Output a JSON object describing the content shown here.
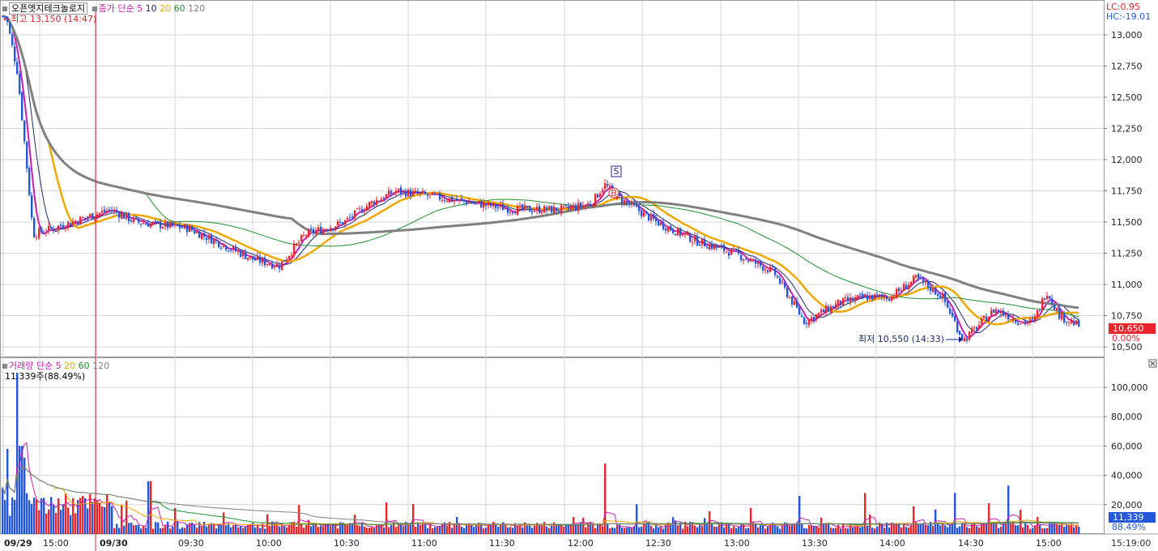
{
  "header": {
    "stock_name": "오픈엣지테크놀로지",
    "price_label": "종가",
    "ma_type": "단순",
    "ma_periods": [
      "5",
      "10",
      "20",
      "60",
      "120"
    ],
    "high_note": "←최고 13,150 (14:47)",
    "lc": "LC:0.95",
    "hc": "HC:-19.01"
  },
  "volume_header": {
    "label": "거래량",
    "ma_type": "단순",
    "ma_periods": [
      "5",
      "20",
      "60",
      "120"
    ],
    "summary": "11,339주(88.49%)"
  },
  "annotations": {
    "low_note": "최저 10,550 (14:33)",
    "current_price": "10,650",
    "current_change": "0.00%",
    "current_volume": "11,339",
    "current_volume_pct": "88.49%",
    "sell_marker": "S",
    "buy_marker": "B",
    "clock": "15:19:00"
  },
  "colors": {
    "up": "#e8262b",
    "down": "#2356d8",
    "ma5": "#c81fb4",
    "ma10": "#1b2a6b",
    "ma20": "#f0a800",
    "ma60": "#1f8f2f",
    "ma120": "#808080",
    "grid": "#d6d6d6",
    "price_tag_bg": "#e8262b",
    "volume_tag_bg": "#2356d8"
  },
  "chart_data": [
    {
      "type": "candlestick",
      "title": "오픈엣지테크놀로지",
      "y_ticks": [
        "13,000",
        "12,750",
        "12,500",
        "12,250",
        "12,000",
        "11,750",
        "11,500",
        "11,250",
        "11,000",
        "10,750",
        "10,500"
      ],
      "ylim": [
        10450,
        13200
      ],
      "x_ticks": [
        "09/29",
        "15:00",
        "09/30",
        "09:30",
        "10:00",
        "10:30",
        "11:00",
        "11:30",
        "12:00",
        "12:30",
        "13:00",
        "13:30",
        "14:00",
        "14:30",
        "15:00"
      ],
      "price_path": {
        "x": [
          "09/29 14:47",
          "09/29 15:05",
          "09/29 15:15",
          "09/29 15:30",
          "09/30 09:05",
          "09/30 09:15",
          "09/30 09:35",
          "09/30 09:50",
          "09/30 10:00",
          "09/30 10:10",
          "09/30 10:20",
          "09/30 10:35",
          "09/30 10:45",
          "09/30 10:55",
          "09/30 11:10",
          "09/30 11:25",
          "09/30 11:40",
          "09/30 12:00",
          "09/30 12:10",
          "09/30 12:15",
          "09/30 12:20",
          "09/30 12:35",
          "09/30 12:50",
          "09/30 13:05",
          "09/30 13:20",
          "09/30 13:32",
          "09/30 13:45",
          "09/30 13:55",
          "09/30 14:05",
          "09/30 14:15",
          "09/30 14:25",
          "09/30 14:33",
          "09/30 14:45",
          "09/30 14:55",
          "09/30 15:00",
          "09/30 15:05",
          "09/30 15:10",
          "09/30 15:19"
        ],
        "close": [
          13150,
          12700,
          12200,
          11400,
          11600,
          11500,
          11450,
          11300,
          11200,
          11150,
          11400,
          11500,
          11650,
          11750,
          11700,
          11650,
          11600,
          11600,
          11650,
          11800,
          11700,
          11500,
          11350,
          11250,
          11100,
          10700,
          10850,
          10900,
          10900,
          11050,
          10900,
          10550,
          10800,
          10700,
          10700,
          10950,
          10750,
          10650
        ]
      },
      "markers": [
        {
          "label": "S",
          "x": "09/30 12:15",
          "price": 11850
        },
        {
          "label": "B",
          "x": "09/30 12:15",
          "price": 11750
        }
      ],
      "high": {
        "value": 13150,
        "time": "14:47"
      },
      "low": {
        "value": 10550,
        "time": "14:33"
      }
    },
    {
      "type": "bar",
      "title": "거래량",
      "y_ticks": [
        "100,000",
        "80,000",
        "60,000",
        "40,000",
        "20,000"
      ],
      "ylim": [
        0,
        120000
      ],
      "spikes": [
        {
          "x": "09/29 14:50",
          "value": 58000
        },
        {
          "x": "09/29 15:05",
          "value": 110000
        },
        {
          "x": "09/29 15:10",
          "value": 60000
        },
        {
          "x": "09/29 15:15",
          "value": 52000
        },
        {
          "x": "09/30 09:20",
          "value": 36000
        },
        {
          "x": "09/30 12:15",
          "value": 48000
        },
        {
          "x": "09/30 13:30",
          "value": 26000
        },
        {
          "x": "09/30 13:55",
          "value": 28000
        },
        {
          "x": "09/30 14:30",
          "value": 28000
        },
        {
          "x": "09/30 14:50",
          "value": 33000
        },
        {
          "x": "09/30 15:19",
          "value": 11339
        }
      ]
    }
  ]
}
